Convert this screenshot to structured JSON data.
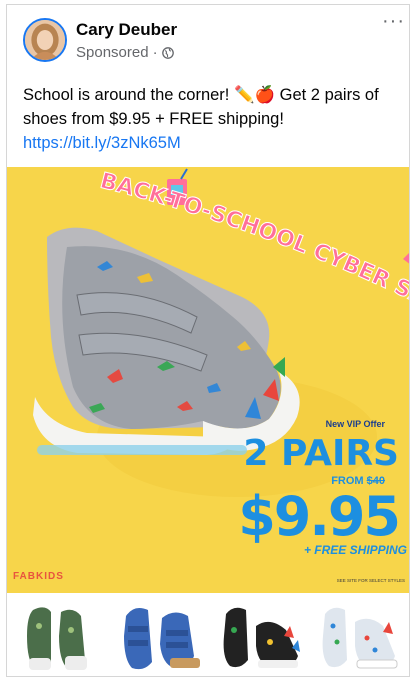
{
  "post": {
    "author": "Cary Deuber",
    "sponsored": "Sponsored",
    "separator": "·",
    "more": "···",
    "caption_text": "School is around the corner! ✏️🍎 Get 2 pairs of shoes from $9.95 + FREE shipping! ",
    "caption_link": "https://bit.ly/3zNk65M"
  },
  "ad": {
    "headline": "BACK-TO-SCHOOL CYBER SALE",
    "vip_offer": "New VIP Offer",
    "pairs": "2 PAIRS",
    "from_label": "FROM ",
    "old_price": "$40",
    "price": "$9.95",
    "free_shipping": "+ FREE SHIPPING",
    "brand": "FABKIDS",
    "fine_print": "SEE SITE FOR SELECT STYLES",
    "colors": {
      "background": "#f7d54a",
      "headline": "#ff6f9a",
      "offer_blue": "#1d8fe0",
      "brand": "#e8543e"
    }
  },
  "products": [
    {
      "name": "green-dino-slip-on-sneaker"
    },
    {
      "name": "blue-strap-sneaker"
    },
    {
      "name": "black-dino-high-top"
    },
    {
      "name": "white-print-high-top"
    }
  ]
}
